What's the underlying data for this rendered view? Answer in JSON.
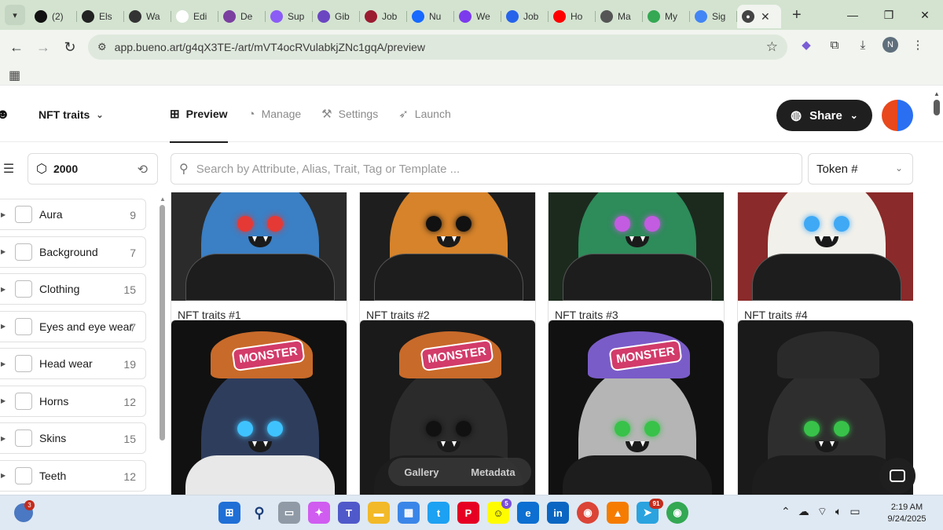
{
  "browser": {
    "tabs": [
      {
        "label": "(2)",
        "icon": "x-icon",
        "color": "#111111"
      },
      {
        "label": "Els",
        "icon": "els-icon",
        "color": "#222222"
      },
      {
        "label": "Wa",
        "icon": "wa-icon",
        "color": "#333333"
      },
      {
        "label": "Edi",
        "icon": "w-icon",
        "color": "#ffffff"
      },
      {
        "label": "De",
        "icon": "de-icon",
        "color": "#7b3fa0"
      },
      {
        "label": "Sup",
        "icon": "sup-icon",
        "color": "#8b5cf6"
      },
      {
        "label": "Gib",
        "icon": "gib-icon",
        "color": "#6b46c1"
      },
      {
        "label": "Job",
        "icon": "job-icon",
        "color": "#9b1c31"
      },
      {
        "label": "Nu",
        "icon": "be-icon",
        "color": "#1769ff"
      },
      {
        "label": "We",
        "icon": "feed-icon",
        "color": "#7c3aed"
      },
      {
        "label": "Job",
        "icon": "stack-icon",
        "color": "#2563eb"
      },
      {
        "label": "Ho",
        "icon": "youtube-icon",
        "color": "#ff0000"
      },
      {
        "label": "Ma",
        "icon": "ma-icon",
        "color": "#555555"
      },
      {
        "label": "My",
        "icon": "drive-icon",
        "color": "#34a853"
      },
      {
        "label": "Sig",
        "icon": "google-icon",
        "color": "#4285f4"
      }
    ],
    "active_tab_icon": "bueno-icon",
    "url": "app.bueno.art/g4qX3TE-/art/mVT4ocRVulabkjZNc1gqA/preview",
    "profile_initial": "N"
  },
  "app": {
    "project_name": "NFT traits",
    "nav": [
      {
        "label": "Preview",
        "icon": "grid-icon",
        "active": true
      },
      {
        "label": "Manage",
        "icon": "palette-icon",
        "active": false
      },
      {
        "label": "Settings",
        "icon": "wrench-icon",
        "active": false
      },
      {
        "label": "Launch",
        "icon": "rocket-icon",
        "active": false
      }
    ],
    "share_label": "Share",
    "count": "2000",
    "search_placeholder": "Search by Attribute, Alias, Trait, Tag or Template ...",
    "sort_label": "Token #",
    "attributes": [
      {
        "name": "Aura",
        "count": "9"
      },
      {
        "name": "Background",
        "count": "7"
      },
      {
        "name": "Clothing",
        "count": "15"
      },
      {
        "name": "Eyes and eye wear",
        "count": "7"
      },
      {
        "name": "Head wear",
        "count": "19"
      },
      {
        "name": "Horns",
        "count": "12"
      },
      {
        "name": "Skins",
        "count": "15"
      },
      {
        "name": "Teeth",
        "count": "12"
      }
    ],
    "cards": [
      {
        "label": "NFT traits #1",
        "bg": "#2b2b2b",
        "fur": "#3b7fc4",
        "eye": "#e53935"
      },
      {
        "label": "NFT traits #2",
        "bg": "#1e1e1e",
        "fur": "#d6832b",
        "eye": "#111111"
      },
      {
        "label": "NFT traits #3",
        "bg": "#1c2a1e",
        "fur": "#2e8b5a",
        "eye": "#c35ce0"
      },
      {
        "label": "NFT traits #4",
        "bg": "#8a2a2a",
        "fur": "#f2f0ea",
        "eye": "#3fa9f5"
      },
      {
        "label": "",
        "bg": "#111111",
        "fur": "#2f3d5c",
        "eye": "#3fc3ff",
        "badge": "MONSTER"
      },
      {
        "label": "",
        "bg": "#1a1a1a",
        "fur": "#2b2b2b",
        "eye": "#111111",
        "badge": "MONSTER"
      },
      {
        "label": "",
        "bg": "#111111",
        "fur": "#b5b5b5",
        "eye": "#38c24a",
        "badge": "MONSTER"
      },
      {
        "label": "",
        "bg": "#1a1a1a",
        "fur": "#2e2e2e",
        "eye": "#38c24a"
      }
    ],
    "view_toggle": {
      "gallery": "Gallery",
      "metadata": "Metadata"
    }
  },
  "taskbar": {
    "notification_badge": "3",
    "snap_badge": "5",
    "telegram_badge": "91",
    "time": "2:19 AM",
    "date": "9/24/2025"
  }
}
